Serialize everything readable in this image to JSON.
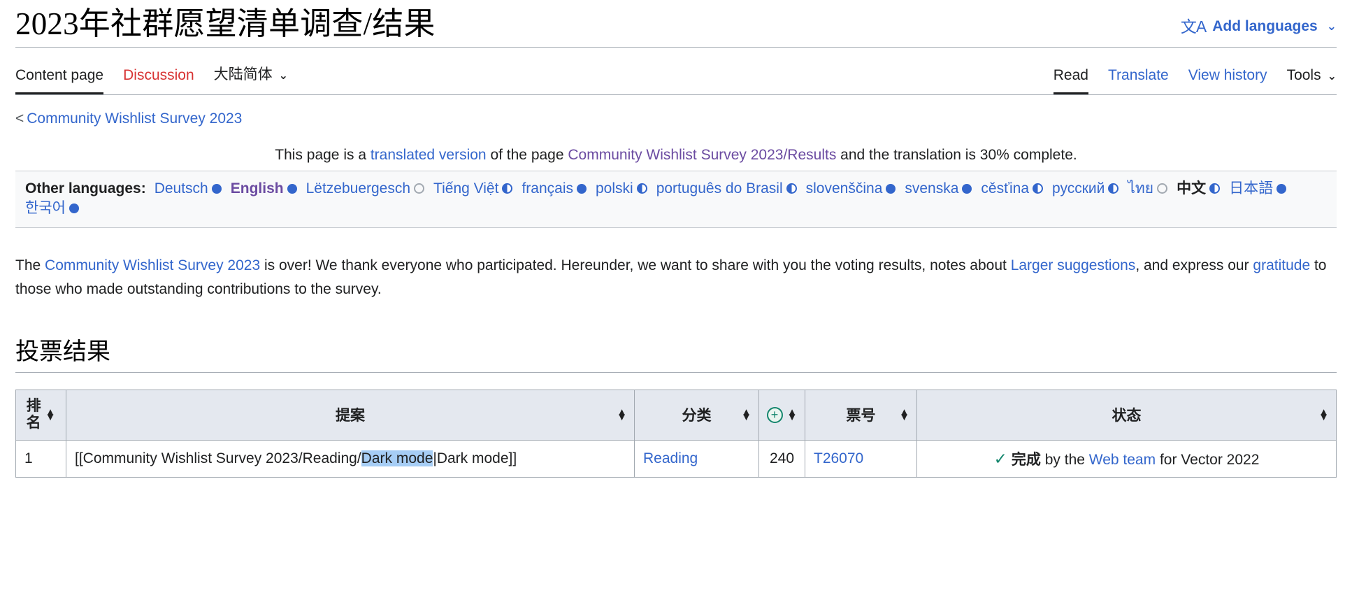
{
  "header": {
    "title": "2023年社群愿望清单调查/结果",
    "add_languages": "Add languages",
    "lang_glyph": "文A",
    "chevron": "⌄"
  },
  "tabs": {
    "left": [
      {
        "label": "Content page",
        "state": "current"
      },
      {
        "label": "Discussion",
        "state": "red"
      },
      {
        "label": "大陆简体",
        "state": "plain",
        "caret": "⌄"
      }
    ],
    "right": [
      {
        "label": "Read",
        "state": "current"
      },
      {
        "label": "Translate",
        "state": "link"
      },
      {
        "label": "View history",
        "state": "link"
      },
      {
        "label": "Tools",
        "state": "plain",
        "caret": "⌄"
      }
    ]
  },
  "breadcrumb": {
    "prefix": "<",
    "link": "Community Wishlist Survey 2023"
  },
  "translate_notice": {
    "part1": "This page is a ",
    "link1": "translated version",
    "part2": " of the page ",
    "link2": "Community Wishlist Survey 2023/Results",
    "part3": " and the translation is 30% complete."
  },
  "other_languages": {
    "label": "Other languages:",
    "items": [
      {
        "name": "Deutsch",
        "pip": "full",
        "style": "link"
      },
      {
        "name": "English",
        "pip": "full",
        "style": "visited"
      },
      {
        "name": "Lëtzebuergesch",
        "pip": "empty",
        "style": "link"
      },
      {
        "name": "Tiếng Việt",
        "pip": "half",
        "style": "link"
      },
      {
        "name": "français",
        "pip": "full",
        "style": "link"
      },
      {
        "name": "polski",
        "pip": "half",
        "style": "link"
      },
      {
        "name": "português do Brasil",
        "pip": "half",
        "style": "link"
      },
      {
        "name": "slovenščina",
        "pip": "full",
        "style": "link"
      },
      {
        "name": "svenska",
        "pip": "full",
        "style": "link"
      },
      {
        "name": "cěsťina",
        "pip": "half",
        "style": "link"
      },
      {
        "name": "русский",
        "pip": "half",
        "style": "link"
      },
      {
        "name": "ไทย",
        "pip": "empty",
        "style": "link"
      },
      {
        "name": "中文",
        "pip": "half",
        "style": "cur"
      },
      {
        "name": "日本語",
        "pip": "full",
        "style": "link"
      },
      {
        "name": "한국어",
        "pip": "full",
        "style": "link"
      }
    ]
  },
  "intro": {
    "t1": "The ",
    "l1": "Community Wishlist Survey 2023",
    "t2": " is over! We thank everyone who participated. Hereunder, we want to share with you the voting results, notes about ",
    "l2": "Larger suggestions",
    "t3": ", and express our ",
    "l3": "gratitude",
    "t4": " to those who made outstanding contributions to the survey."
  },
  "section": {
    "heading": "投票结果"
  },
  "results_table": {
    "columns": [
      {
        "key": "rank",
        "label": "排名",
        "sortable": true
      },
      {
        "key": "proposal",
        "label": "提案",
        "sortable": true
      },
      {
        "key": "category",
        "label": "分类",
        "sortable": true
      },
      {
        "key": "plus",
        "label": "⊕",
        "sortable": true,
        "icon": "plus-circle-icon"
      },
      {
        "key": "votes",
        "label": "票号",
        "sortable": true
      },
      {
        "key": "status",
        "label": "状态",
        "sortable": true
      }
    ],
    "rows": [
      {
        "rank": "1",
        "proposal_prefix": "[[Community Wishlist Survey 2023/Reading/",
        "proposal_selected": "Dark mode",
        "proposal_suffix": "|Dark mode]]",
        "category": "Reading",
        "plus": "240",
        "votes": "T26070",
        "status_check": "✓",
        "status_label": "完成",
        "status_mid": " by the ",
        "status_link": "Web team",
        "status_tail": " for Vector 2022"
      }
    ]
  },
  "colors": {
    "link": "#3366cc",
    "visited": "#6b4ba1",
    "red_link": "#d73333",
    "green": "#14866d",
    "selection": "#a6cdf5",
    "header_bg": "#e4e8ef",
    "box_bg": "#f8f9fa",
    "border": "#a2a9b1"
  }
}
